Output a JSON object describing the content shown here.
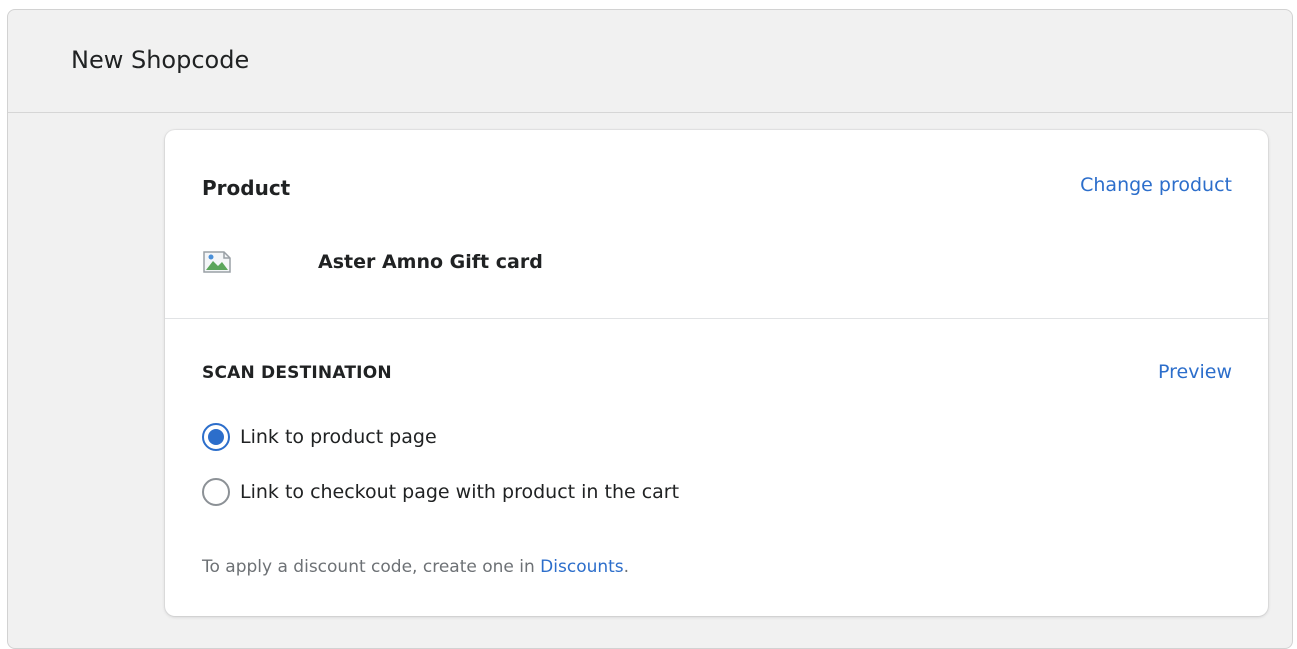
{
  "window": {
    "title": "New Shopcode"
  },
  "product": {
    "heading": "Product",
    "change_link": "Change product",
    "name": "Aster Amno Gift card",
    "image_icon": "broken-image-icon"
  },
  "scan_destination": {
    "heading": "SCAN DESTINATION",
    "preview_link": "Preview",
    "options": [
      {
        "label": "Link to product page",
        "selected": true
      },
      {
        "label": "Link to checkout page with product in the cart",
        "selected": false
      }
    ],
    "help_prefix": "To apply a discount code, create one in ",
    "help_link": "Discounts",
    "help_suffix": "."
  },
  "colors": {
    "accent": "#2c6ecb",
    "text": "#202223",
    "subdued": "#6d7175",
    "background": "#f1f1f1"
  }
}
